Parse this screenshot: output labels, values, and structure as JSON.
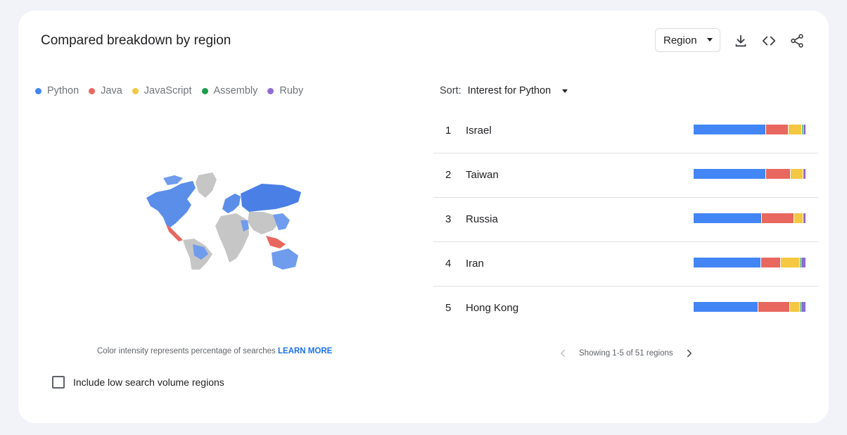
{
  "card": {
    "title": "Compared breakdown by region",
    "region_select": "Region",
    "icons": [
      "download-icon",
      "embed-icon",
      "share-icon"
    ]
  },
  "legend": [
    {
      "label": "Python",
      "color": "#4285f4"
    },
    {
      "label": "Java",
      "color": "#e8675f"
    },
    {
      "label": "JavaScript",
      "color": "#f4c842"
    },
    {
      "label": "Assembly",
      "color": "#1e9e4a"
    },
    {
      "label": "Ruby",
      "color": "#8e6dd1"
    }
  ],
  "map_note": {
    "text": "Color intensity represents percentage of searches",
    "link": "LEARN MORE"
  },
  "low_volume": {
    "label": "Include low search volume regions",
    "checked": false
  },
  "sort": {
    "label": "Sort:",
    "value": "Interest for Python"
  },
  "regions": [
    {
      "rank": "1",
      "name": "Israel",
      "shares": [
        64,
        20,
        12,
        1,
        2
      ]
    },
    {
      "rank": "2",
      "name": "Taiwan",
      "shares": [
        64,
        22,
        11,
        0,
        2
      ]
    },
    {
      "rank": "3",
      "name": "Russia",
      "shares": [
        61,
        29,
        8,
        0,
        2
      ]
    },
    {
      "rank": "4",
      "name": "Iran",
      "shares": [
        60,
        17,
        17,
        1,
        4
      ]
    },
    {
      "rank": "5",
      "name": "Hong Kong",
      "shares": [
        57,
        28,
        9,
        1,
        4
      ]
    }
  ],
  "pager": {
    "text": "Showing 1-5 of 51 regions"
  }
}
